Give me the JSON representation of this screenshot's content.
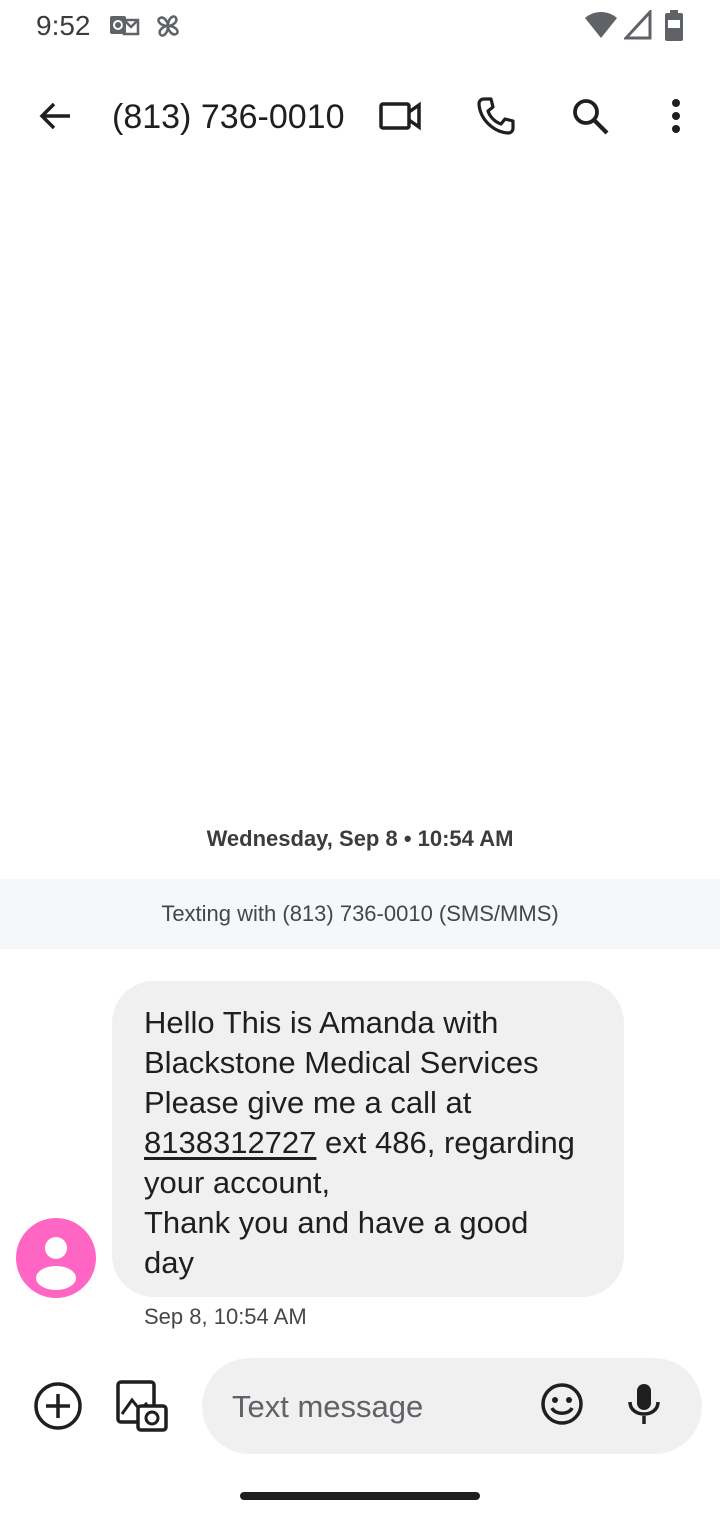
{
  "status_bar": {
    "time": "9:52",
    "icons": [
      "outlook-icon",
      "pinwheel-icon",
      "wifi-icon",
      "signal-icon",
      "battery-icon"
    ]
  },
  "toolbar": {
    "title": "(813) 736-0010",
    "icons": [
      "back-arrow-icon",
      "video-call-icon",
      "phone-call-icon",
      "search-icon",
      "more-vert-icon"
    ]
  },
  "conversation": {
    "date_header": "Wednesday, Sep 8 • 10:54 AM",
    "sms_banner": "Texting with (813) 736-0010 (SMS/MMS)",
    "message": {
      "lines": {
        "l1": "Hello This is Amanda with",
        "l2": "Blackstone Medical Services",
        "l3": "Please give me a call at",
        "phone": "8138312727",
        "l4_rest": " ext 486, regarding",
        "l5": "your account,",
        "l6": "Thank you and have a good",
        "l7": "day"
      },
      "timestamp": "Sep 8, 10:54 AM",
      "avatar_color": "#ff66c4"
    }
  },
  "compose": {
    "placeholder": "Text message",
    "icons": [
      "add-circle-icon",
      "gallery-icon",
      "emoji-icon",
      "mic-icon"
    ]
  }
}
